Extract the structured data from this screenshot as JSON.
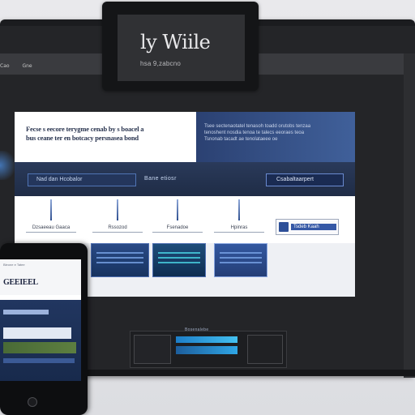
{
  "logo": {
    "title": "ly Wiile",
    "subtitle": "hsa 9,zabcno"
  },
  "browser": {
    "nav": [
      "Cao",
      "Gne"
    ]
  },
  "hero": {
    "left_lines": [
      "Fecse s eecore terygme cenab by s boacel a",
      "bus ceane ter en botcacy persnasea bond"
    ],
    "right_lines": [
      "Tsee sectenaotatel tenasoh toadd orutobs tenzaa",
      "tenoshent nosdia tenoa te talecs eeoraes teoa",
      "Tsnonab tacadt ae tenolataeee oe"
    ]
  },
  "strip": {
    "left": "Nad dan Hcobalor",
    "mid": "Bane etiosr",
    "button": "Csabaltaarpert"
  },
  "features": {
    "items": [
      "Dzsaeeau Gaaca",
      "Rssozod",
      "Fsenadoe",
      "Hpinras"
    ],
    "box_label": "Tsdeb Kaah"
  },
  "phone": {
    "nav": "Bleone e  Tatee",
    "title": "GEEIEEL"
  },
  "dashboard": {
    "label": "Bosenalebe"
  },
  "colors": {
    "accent": "#2d4f98",
    "hero_blue": "#2b4172",
    "highlight_cyan": "#43c0f0",
    "bezel": "#1b1c1f"
  }
}
